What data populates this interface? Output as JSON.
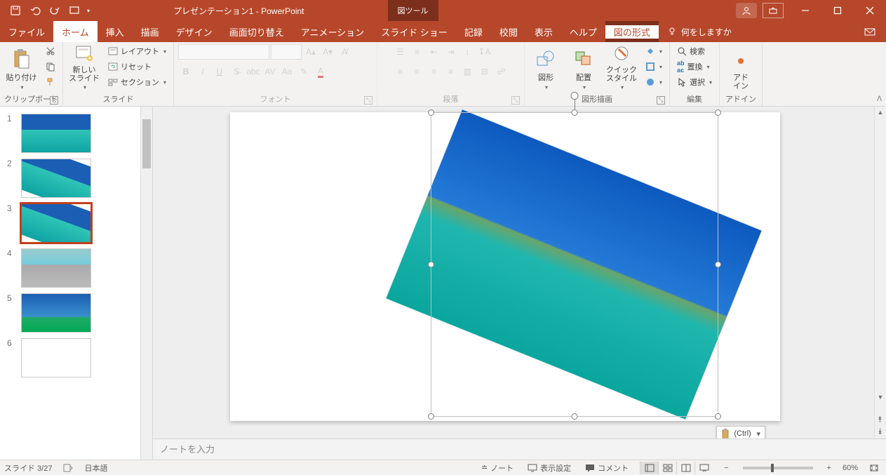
{
  "titlebar": {
    "doc_title": "プレゼンテーション1 - PowerPoint",
    "tool_tab_label": "図ツール"
  },
  "tabs": {
    "file": "ファイル",
    "home": "ホーム",
    "insert": "挿入",
    "draw": "描画",
    "design": "デザイン",
    "transitions": "画面切り替え",
    "animations": "アニメーション",
    "slideshow": "スライド ショー",
    "record": "記録",
    "review": "校閲",
    "view": "表示",
    "help": "ヘルプ",
    "picture_format": "図の形式",
    "tell_me": "何をしますか"
  },
  "ribbon": {
    "clipboard": {
      "label": "クリップボード",
      "paste": "貼り付け"
    },
    "slides": {
      "label": "スライド",
      "new_slide": "新しい\nスライド",
      "layout": "レイアウト",
      "reset": "リセット",
      "section": "セクション"
    },
    "font": {
      "label": "フォント"
    },
    "paragraph": {
      "label": "段落"
    },
    "drawing": {
      "label": "図形描画",
      "shapes": "図形",
      "arrange": "配置",
      "quick_styles": "クイック\nスタイル"
    },
    "editing": {
      "label": "編集",
      "find": "検索",
      "replace": "置換",
      "select": "選択"
    },
    "addins": {
      "label": "アドイン",
      "addins_btn": "アド\nイン"
    }
  },
  "thumbnails": {
    "items": [
      {
        "num": "1"
      },
      {
        "num": "2"
      },
      {
        "num": "3"
      },
      {
        "num": "4"
      },
      {
        "num": "5"
      },
      {
        "num": "6"
      }
    ],
    "selected_index": 2
  },
  "canvas": {
    "paste_options": "(Ctrl)"
  },
  "notes": {
    "placeholder": "ノートを入力"
  },
  "statusbar": {
    "slide_counter": "スライド 3/27",
    "language": "日本語",
    "notes_btn": "ノート",
    "display_settings": "表示設定",
    "comments": "コメント",
    "zoom_pct": "60%"
  }
}
